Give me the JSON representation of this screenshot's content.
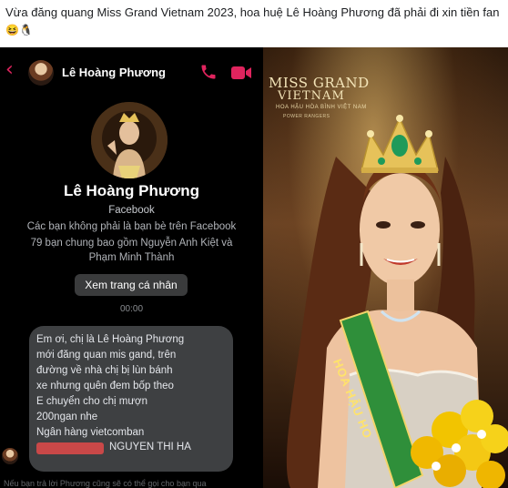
{
  "post": {
    "caption": "Vừa đăng quang Miss Grand Vietnam 2023, hoa huệ Lê Hoàng Phương đã phải đi xin tiền fan",
    "caption_emojis": "😆🐧"
  },
  "messenger": {
    "contact_name": "Lê Hoàng Phương",
    "profile": {
      "name": "Lê Hoàng Phương",
      "platform": "Facebook",
      "not_friends": "Các bạn không phải là bạn bè trên Facebook",
      "mutual_line1": "79 bạn chung bao gồm Nguyễn Anh Kiệt và",
      "mutual_line2": "Phạm Minh Thành",
      "view_profile_button": "Xem trang cá nhân"
    },
    "timestamp": "00:00",
    "message": {
      "lines": [
        "Em ơi, chị là Lê Hoàng Phương",
        "mới đăng quan mis gand, trên",
        "đường về nhà chị bị lùn bánh",
        "xe nhưng quên đem bốp theo",
        "E chuyển cho chị mượn",
        "200ngan nhe",
        "Ngân hàng vietcomban"
      ],
      "account_holder": "NGUYEN THI HA"
    },
    "footer_note": "Nếu bạn trả lời Phương cũng sẽ có thể gọi cho bạn qua"
  },
  "photo": {
    "logo_line1": "MISS GRAND",
    "logo_line2": "VIETNAM",
    "logo_sub": "HOA HẬU HÒA BÌNH VIỆT NAM",
    "logo_sub2": "POWER RANGERS",
    "sash_text": "HOA HẬU HO"
  },
  "colors": {
    "accent_red": "#e0245e",
    "bubble": "#3e4042",
    "button": "#3a3b3c",
    "gold": "#e6c25a",
    "sash_green": "#2f8f3a"
  },
  "icons": [
    "back-chevron-icon",
    "phone-call-icon",
    "video-call-icon",
    "crown-icon"
  ]
}
